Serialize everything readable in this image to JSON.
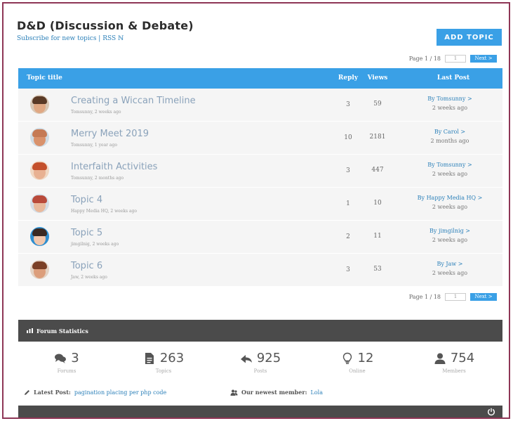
{
  "forum": {
    "title": "D&D (Discussion & Debate)",
    "subscribe_text": "Subscribe for new topics | RSS ℕ",
    "add_topic_label": "ADD TOPIC"
  },
  "pagination": {
    "text": "Page 1 / 18",
    "page_value": "1",
    "next_label": "Next >"
  },
  "table": {
    "headers": {
      "title": "Topic title",
      "reply": "Reply",
      "views": "Views",
      "last_post": "Last Post"
    },
    "rows": [
      {
        "title": "Creating a Wiccan Timeline",
        "meta": "Tomsunny, 2 weeks ago",
        "reply": "3",
        "views": "59",
        "last_by": "By Tomsunny >",
        "last_time": "2 weeks ago",
        "avatar_icon": "avatar-man-bearded"
      },
      {
        "title": "Merry Meet 2019",
        "meta": "Tomsunny, 1 year ago",
        "reply": "10",
        "views": "2181",
        "last_by": "By Carol >",
        "last_time": "2 months ago",
        "avatar_icon": "avatar-man-bald"
      },
      {
        "title": "Interfaith Activities",
        "meta": "Tomsunny, 2 months ago",
        "reply": "3",
        "views": "447",
        "last_by": "By Tomsunny >",
        "last_time": "2 weeks ago",
        "avatar_icon": "avatar-woman-red"
      },
      {
        "title": "Topic 4",
        "meta": "Happy Media HQ, 2 weeks ago",
        "reply": "1",
        "views": "10",
        "last_by": "By Happy Media HQ >",
        "last_time": "2 weeks ago",
        "avatar_icon": "avatar-man-glasses"
      },
      {
        "title": "Topic 5",
        "meta": "jimgilnig, 2 weeks ago",
        "reply": "2",
        "views": "11",
        "last_by": "By jimgilnig >",
        "last_time": "2 weeks ago",
        "avatar_icon": "avatar-woman-dark"
      },
      {
        "title": "Topic 6",
        "meta": "Jaw, 2 weeks ago",
        "reply": "3",
        "views": "53",
        "last_by": "By Jaw >",
        "last_time": "2 weeks ago",
        "avatar_icon": "avatar-man-beard"
      }
    ]
  },
  "stats": {
    "title": "Forum Statistics",
    "items": [
      {
        "value": "3",
        "label": "Forums",
        "icon": "comments-icon"
      },
      {
        "value": "263",
        "label": "Topics",
        "icon": "document-icon"
      },
      {
        "value": "925",
        "label": "Posts",
        "icon": "reply-icon"
      },
      {
        "value": "12",
        "label": "Online",
        "icon": "lightbulb-icon"
      },
      {
        "value": "754",
        "label": "Members",
        "icon": "user-icon"
      }
    ],
    "latest_post_label": "Latest Post:",
    "latest_post_link": "pagination placing per php code",
    "newest_member_label": "Our newest member:",
    "newest_member_link": "Lola"
  },
  "colors": {
    "accent": "#3aa0e6",
    "frame": "#8e3656",
    "dark_bar": "#4b4b4b",
    "link": "#2c80b9"
  }
}
